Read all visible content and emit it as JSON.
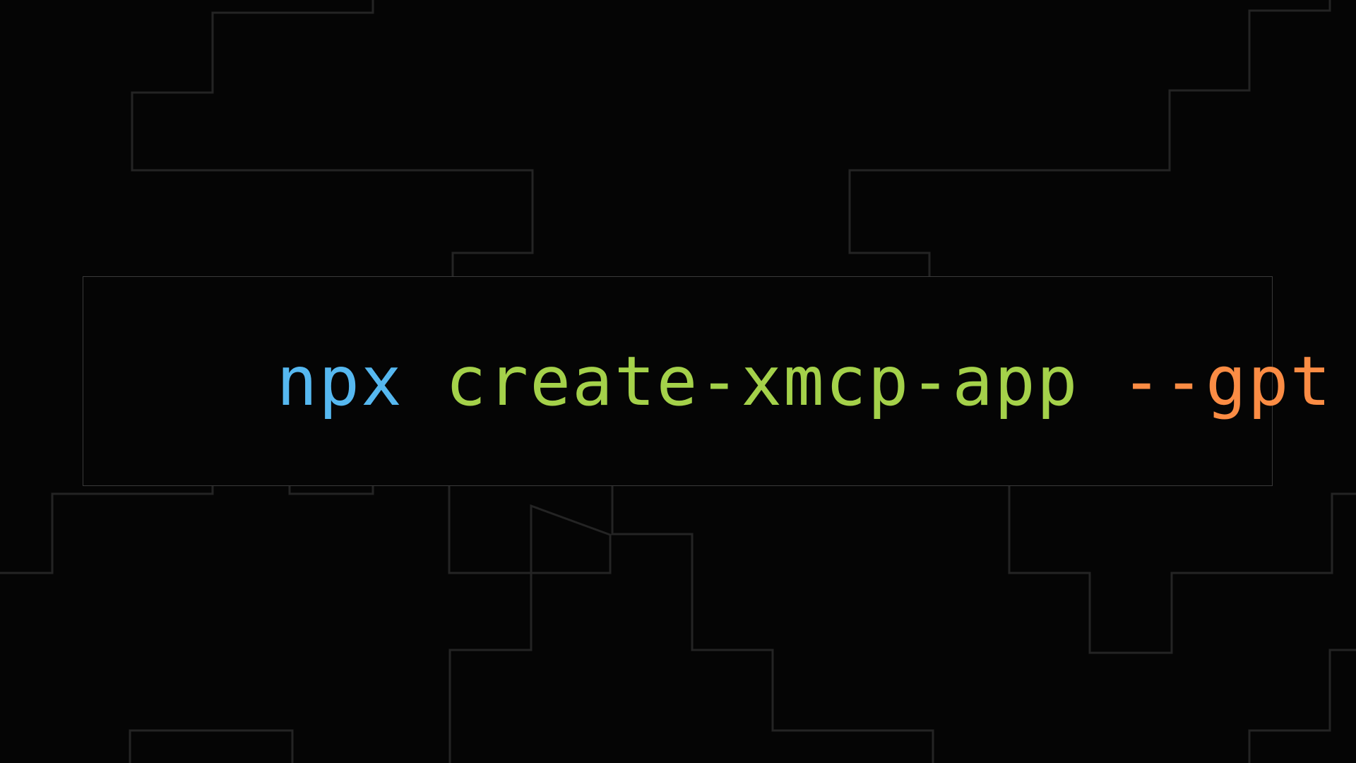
{
  "command": {
    "tokens": [
      {
        "text": "npx",
        "color": "#56b8f0"
      },
      {
        "text": " ",
        "color": "#ffffff"
      },
      {
        "text": "create-xmcp-app",
        "color": "#a4d14a"
      },
      {
        "text": " ",
        "color": "#ffffff"
      },
      {
        "text": "--gpt",
        "color": "#fb8c44"
      }
    ]
  },
  "theme": {
    "background": "#050505",
    "line_color": "#242424",
    "box_border": "#3a3a3a"
  }
}
